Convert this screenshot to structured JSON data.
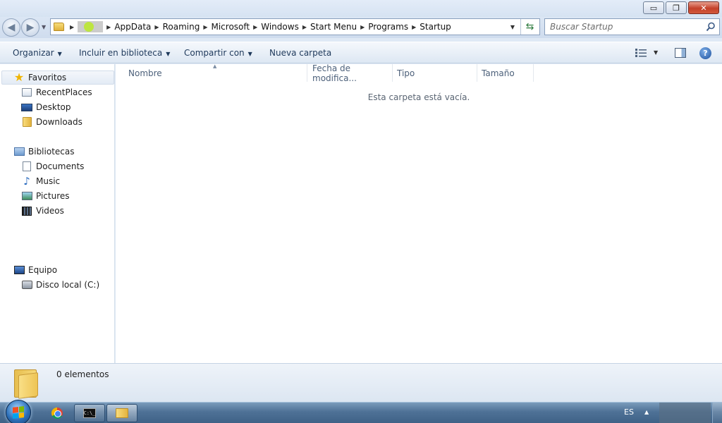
{
  "window": {
    "minimize_glyph": "▭",
    "maximize_glyph": "❐",
    "close_glyph": "✕"
  },
  "address": {
    "crumbs": [
      "AppData",
      "Roaming",
      "Microsoft",
      "Windows",
      "Start Menu",
      "Programs",
      "Startup"
    ]
  },
  "search": {
    "placeholder": "Buscar Startup"
  },
  "toolbar": {
    "organize": "Organizar",
    "include_library": "Incluir en biblioteca",
    "share_with": "Compartir con",
    "new_folder": "Nueva carpeta"
  },
  "nav": {
    "favorites": {
      "label": "Favoritos",
      "items": [
        "RecentPlaces",
        "Desktop",
        "Downloads"
      ]
    },
    "libraries": {
      "label": "Bibliotecas",
      "items": [
        "Documents",
        "Music",
        "Pictures",
        "Videos"
      ]
    },
    "computer": {
      "label": "Equipo",
      "items": [
        "Disco local (C:)"
      ]
    }
  },
  "columns": [
    "Nombre",
    "Fecha de modifica...",
    "Tipo",
    "Tamaño"
  ],
  "content": {
    "empty_message": "Esta carpeta está vacía."
  },
  "details": {
    "item_count": "0 elementos"
  },
  "taskbar": {
    "language": "ES",
    "cmd_label": "C:\\_"
  },
  "icons": {
    "favorites": "star-icon",
    "libraries": "library-icon",
    "computer": "computer-icon",
    "refresh": "refresh-icon",
    "search": "search-icon"
  }
}
